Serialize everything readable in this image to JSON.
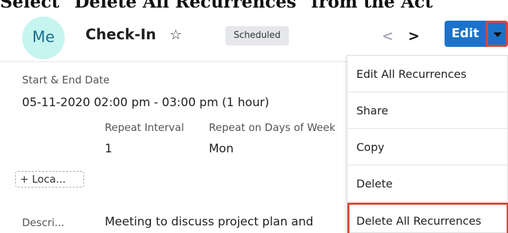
{
  "caption": "Select \"Delete All Recurrences\" from the Act",
  "header": {
    "avatar_text": "Me",
    "record_name": "Check-In",
    "star_glyph": "☆",
    "status": "Scheduled",
    "prev_glyph": "<",
    "next_glyph": ">",
    "edit_label": "Edit"
  },
  "fields": {
    "start_end_label": "Start & End Date",
    "start_end_value": "05-11-2020 02:00 pm - 03:00 pm (1 hour)",
    "repeat_interval_label": "Repeat Interval",
    "repeat_interval_value": "1",
    "repeat_days_label": "Repeat on Days of Week",
    "repeat_days_value": "Mon",
    "location_label": "+ Loca...",
    "description_label": "Descri...",
    "description_value": "Meeting to discuss project plan and"
  },
  "menu": {
    "items": [
      "Edit All Recurrences",
      "Share",
      "Copy",
      "Delete",
      "Delete All Recurrences"
    ]
  },
  "colors": {
    "accent": "#1a73c9",
    "highlight": "#d9483b",
    "avatar_bg": "#c6f5f0"
  }
}
